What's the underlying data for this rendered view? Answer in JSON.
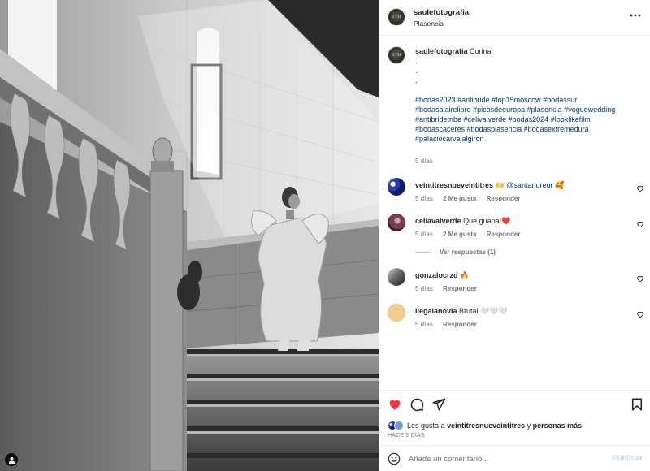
{
  "post": {
    "username": "saulefotografia",
    "location": "Plasencia",
    "avatar_text": "STH"
  },
  "caption": {
    "username": "saulefotografia",
    "text": "Corina",
    "dots": [
      ".",
      ".",
      ".",
      "."
    ],
    "hashtags": [
      "#bodas2023",
      "#antibride",
      "#top15moscow",
      "#bodassur",
      "#bodasalairelibre",
      "#picosdeeuropa",
      "#plasencia",
      "#voguewedding",
      "#antibridetribe",
      "#celivalverde",
      "#bodas2024",
      "#looklikefilm",
      "#bodascaceres",
      "#bodasplasencia",
      "#bodasextremedura",
      "#palaciocarvajalgiron"
    ],
    "time": "5 días"
  },
  "comments": [
    {
      "username": "veintitresnueveintitres",
      "text": "🙌",
      "mention": "@santandreur",
      "suffix": "🥰",
      "time": "5 días",
      "likes": "2 Me gusta",
      "reply": "Responder"
    },
    {
      "username": "celiavalverde",
      "text": "Que guapa!❤️",
      "mention": "",
      "suffix": "",
      "time": "5 días",
      "likes": "2 Me gusta",
      "reply": "Responder"
    },
    {
      "username": "gonzalocrzd",
      "text": "🔥",
      "mention": "",
      "suffix": "",
      "time": "5 días",
      "likes": "",
      "reply": "Responder"
    },
    {
      "username": "llegalanovia",
      "text": "Brutal 🤍🤍🤍",
      "mention": "",
      "suffix": "",
      "time": "5 días",
      "likes": "",
      "reply": "Responder"
    }
  ],
  "replies_toggle": "Ver respuestas (1)",
  "likes": {
    "prefix": "Les gusta a",
    "user": "veintitresnueveintitres",
    "connector": "y",
    "others": "personas más"
  },
  "post_time": "HACE 5 DÍAS",
  "comment_box": {
    "placeholder": "Añade un comentario...",
    "publish": "Publicar"
  },
  "colors": {
    "like_red": "#ff3040",
    "link_blue": "#00376b",
    "publish_disabled": "#b2dffc"
  },
  "icons": [
    "more-icon",
    "heart-icon",
    "comment-icon",
    "share-icon",
    "bookmark-icon",
    "emoji-icon",
    "user-tag-icon"
  ]
}
